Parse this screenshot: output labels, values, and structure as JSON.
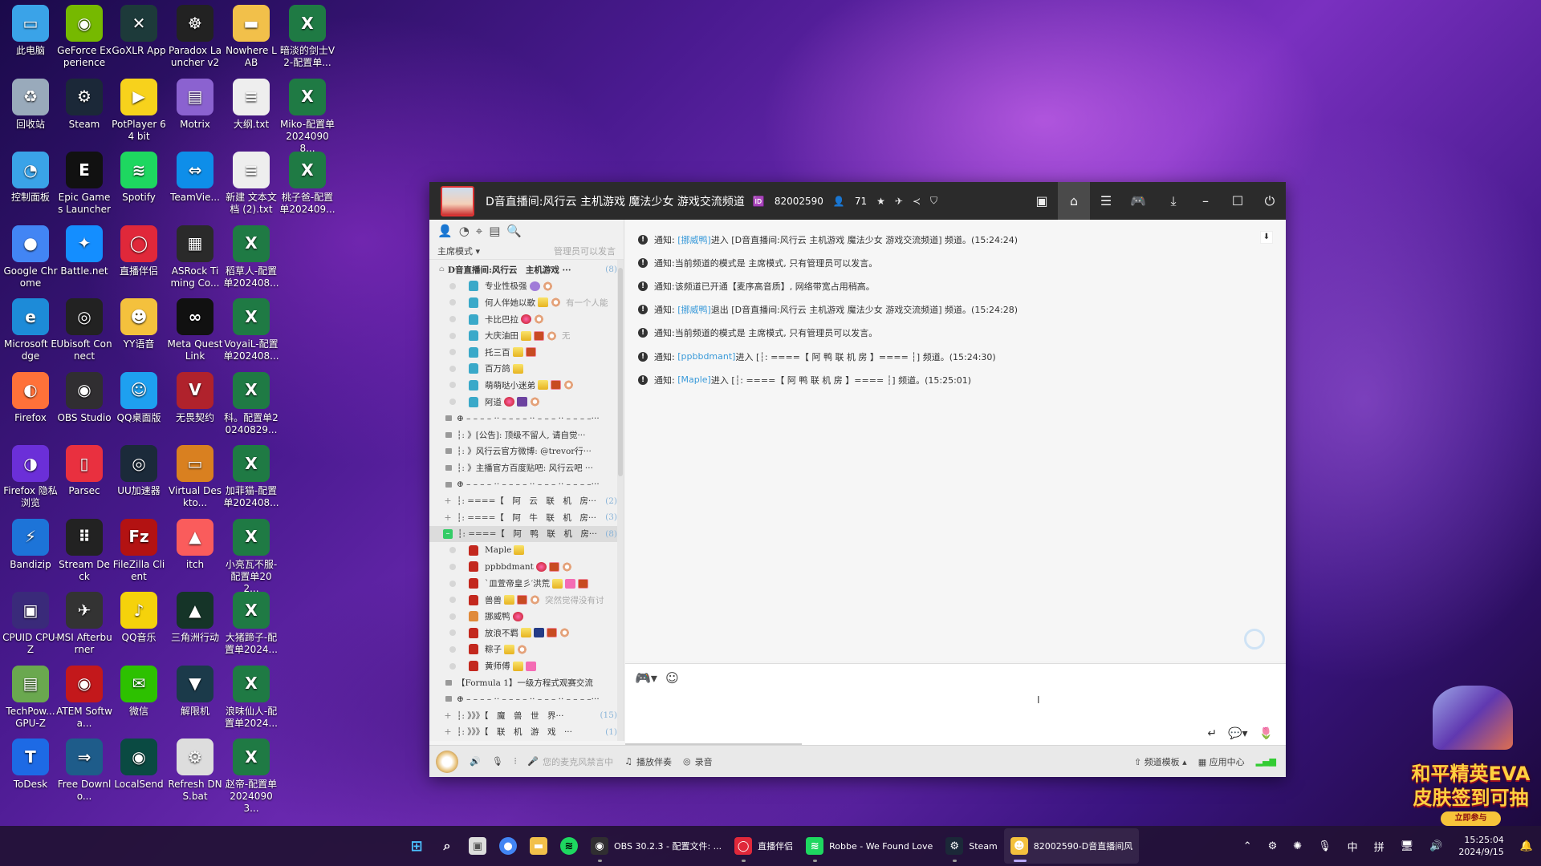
{
  "desktop": {
    "icons": [
      {
        "label": "此电脑",
        "color": "#3aa3e8",
        "glyph": "▭"
      },
      {
        "label": "GeForce Experience",
        "color": "#76b900",
        "glyph": "◉"
      },
      {
        "label": "GoXLR App",
        "color": "#1d3a3a",
        "glyph": "✕"
      },
      {
        "label": "Paradox Launcher v2",
        "color": "#222",
        "glyph": "☸"
      },
      {
        "label": "Nowhere LAB",
        "color": "#f2c04a",
        "glyph": "▬"
      },
      {
        "label": "暗淡的剑士V2-配置单...",
        "color": "#1f7a44",
        "glyph": "X"
      },
      {
        "label": "回收站",
        "color": "#9ab",
        "glyph": "♻"
      },
      {
        "label": "Steam",
        "color": "#1b2838",
        "glyph": "⚙"
      },
      {
        "label": "PotPlayer 64 bit",
        "color": "#f7d21c",
        "glyph": "▶"
      },
      {
        "label": "Motrix",
        "color": "#8b62d0",
        "glyph": "▤"
      },
      {
        "label": "大纲.txt",
        "color": "#eee",
        "glyph": "≡"
      },
      {
        "label": "Miko-配置单20240908...",
        "color": "#1f7a44",
        "glyph": "X"
      },
      {
        "label": "控制面板",
        "color": "#3aa3e8",
        "glyph": "◔"
      },
      {
        "label": "Epic Games Launcher",
        "color": "#111",
        "glyph": "E"
      },
      {
        "label": "Spotify",
        "color": "#1ed760",
        "glyph": "≋"
      },
      {
        "label": "TeamVie...",
        "color": "#0e8ee9",
        "glyph": "⇔"
      },
      {
        "label": "新建 文本文档 (2).txt",
        "color": "#eee",
        "glyph": "≡"
      },
      {
        "label": "桃子爸-配置单202409...",
        "color": "#1f7a44",
        "glyph": "X"
      },
      {
        "label": "Google Chrome",
        "color": "#4285f4",
        "glyph": "●"
      },
      {
        "label": "Battle.net",
        "color": "#148eff",
        "glyph": "✦"
      },
      {
        "label": "直播伴侣",
        "color": "#e0283a",
        "glyph": "◯"
      },
      {
        "label": "ASRock Timing Co...",
        "color": "#2a2a2a",
        "glyph": "▦"
      },
      {
        "label": "稻草人-配置单202408...",
        "color": "#1f7a44",
        "glyph": "X"
      },
      {
        "label": "Microsoft Edge",
        "color": "#1d8bd8",
        "glyph": "e"
      },
      {
        "label": "Ubisoft Connect",
        "color": "#222",
        "glyph": "◎"
      },
      {
        "label": "YY语音",
        "color": "#f4c13d",
        "glyph": "☻"
      },
      {
        "label": "Meta Quest Link",
        "color": "#111",
        "glyph": "∞"
      },
      {
        "label": "VoyaiL-配置单202408...",
        "color": "#1f7a44",
        "glyph": "X"
      },
      {
        "label": "Firefox",
        "color": "#ff7139",
        "glyph": "◐"
      },
      {
        "label": "OBS Studio",
        "color": "#302e31",
        "glyph": "◉"
      },
      {
        "label": "QQ桌面版",
        "color": "#1ea0f0",
        "glyph": "☺"
      },
      {
        "label": "无畏契约",
        "color": "#b0222c",
        "glyph": "V"
      },
      {
        "label": "科。配置单20240829...",
        "color": "#1f7a44",
        "glyph": "X"
      },
      {
        "label": "Firefox 隐私浏览",
        "color": "#6b2fd8",
        "glyph": "◑"
      },
      {
        "label": "Parsec",
        "color": "#e9303f",
        "glyph": "▯"
      },
      {
        "label": "UU加速器",
        "color": "#1b2a3a",
        "glyph": "◎"
      },
      {
        "label": "Virtual Deskto...",
        "color": "#d98020",
        "glyph": "▭"
      },
      {
        "label": "加菲猫-配置单202408...",
        "color": "#1f7a44",
        "glyph": "X"
      },
      {
        "label": "Bandizip",
        "color": "#1d74d8",
        "glyph": "⚡"
      },
      {
        "label": "Stream Deck",
        "color": "#222",
        "glyph": "⠿"
      },
      {
        "label": "FileZilla Client",
        "color": "#b31212",
        "glyph": "Fz"
      },
      {
        "label": "itch",
        "color": "#fa5c5c",
        "glyph": "▲"
      },
      {
        "label": "小亮瓦不服-配置单202...",
        "color": "#1f7a44",
        "glyph": "X"
      },
      {
        "label": "CPUID CPU-Z",
        "color": "#3a2a7a",
        "glyph": "▣"
      },
      {
        "label": "MSI Afterburner",
        "color": "#333",
        "glyph": "✈"
      },
      {
        "label": "QQ音乐",
        "color": "#f5d20b",
        "glyph": "♪"
      },
      {
        "label": "三角洲行动",
        "color": "#153428",
        "glyph": "▲"
      },
      {
        "label": "大猪蹄子-配置单2024...",
        "color": "#1f7a44",
        "glyph": "X"
      },
      {
        "label": "TechPow... GPU-Z",
        "color": "#6aa84f",
        "glyph": "▤"
      },
      {
        "label": "ATEM Softwa...",
        "color": "#c3181b",
        "glyph": "◉"
      },
      {
        "label": "微信",
        "color": "#2dc100",
        "glyph": "✉"
      },
      {
        "label": "解限机",
        "color": "#1b3a4a",
        "glyph": "▼"
      },
      {
        "label": "浪味仙人-配置单2024...",
        "color": "#1f7a44",
        "glyph": "X"
      },
      {
        "label": "ToDesk",
        "color": "#1d6ae5",
        "glyph": "T"
      },
      {
        "label": "Free Downlo...",
        "color": "#1e5c8a",
        "glyph": "⇒"
      },
      {
        "label": "LocalSend",
        "color": "#0a4a42",
        "glyph": "◉"
      },
      {
        "label": "Refresh DNS.bat",
        "color": "#ddd",
        "glyph": "⚙"
      },
      {
        "label": "赵帝-配置单20240903...",
        "color": "#1f7a44",
        "glyph": "X"
      }
    ]
  },
  "window": {
    "title": "D音直播间:风行云 主机游戏 魔法少女 游戏交流频道",
    "channel_id": "82002590",
    "online_count": "71",
    "controls": [
      "video-icon",
      "home-icon",
      "list-icon",
      "gamepad-icon",
      "download-icon",
      "minimize-icon",
      "maximize-icon",
      "power-icon"
    ]
  },
  "left_panel": {
    "mode_label": "主席模式",
    "mode_note": "管理员可以发言",
    "root_channel": {
      "label": "D音直播间:风行云　主机游戏 ···",
      "count": "(8)"
    },
    "root_users": [
      {
        "name": "专业性极强",
        "color": "blue",
        "badges": [
          "purple",
          "ring"
        ],
        "tail": ""
      },
      {
        "name": "何人伴她以歌",
        "color": "blue",
        "badges": [
          "crown-gold",
          "ring"
        ],
        "tail": "有一个人能"
      },
      {
        "name": "卡比巴拉",
        "color": "blue",
        "badges": [
          "crown-red",
          "ring"
        ],
        "tail": ""
      },
      {
        "name": "大庆油田",
        "color": "blue",
        "badges": [
          "crown-gold",
          "cai",
          "ring"
        ],
        "tail": "无"
      },
      {
        "name": "托三百",
        "color": "blue",
        "badges": [
          "crown-gold",
          "cai"
        ],
        "tail": ""
      },
      {
        "name": "百万鸽",
        "color": "blue",
        "badges": [
          "crown-gold"
        ],
        "tail": ""
      },
      {
        "name": "萌萌哒小迷弟",
        "color": "blue",
        "badges": [
          "crown-gold",
          "cai",
          "ring"
        ],
        "tail": ""
      },
      {
        "name": "阿道",
        "color": "blue",
        "badges": [
          "crown-red",
          "zong",
          "ring"
        ],
        "tail": ""
      }
    ],
    "sub_channels_1": [
      {
        "type": "sep",
        "label": "⊕ – – – – ·· – – – – ·· – – – ·· – – – –···"
      },
      {
        "type": "lock",
        "label": "┆: 》[公告]: 顶级不留人, 请自觉···"
      },
      {
        "type": "lock",
        "label": "┆: 》风行云官方微博: @trevor行···"
      },
      {
        "type": "lock",
        "label": "┆: 》主播官方百度贴吧: 风行云吧 ···"
      },
      {
        "type": "sep",
        "label": "⊕ – – – – ·· – – – – ·· – – – ·· – – – –···"
      },
      {
        "type": "plus",
        "label": "┆: ====【　阿　云　联　机　房···",
        "count": "(2)"
      },
      {
        "type": "plus",
        "label": "┆: ====【　阿　牛　联　机　房···",
        "count": "(3)"
      },
      {
        "type": "open",
        "label": "┆: ====【　阿　鸭　联　机　房···",
        "count": "(8)"
      }
    ],
    "duck_users": [
      {
        "name": "Maple",
        "color": "red",
        "badges": [
          "crown-gold"
        ],
        "tail": ""
      },
      {
        "name": "ppbbdmant",
        "color": "red",
        "badges": [
          "crown-red",
          "cai",
          "ring"
        ],
        "tail": ""
      },
      {
        "name": "`皿萱帝皇彡′洪荒",
        "color": "red",
        "badges": [
          "crown-gold",
          "pink",
          "cai"
        ],
        "tail": ""
      },
      {
        "name": "兽兽",
        "color": "red",
        "badges": [
          "crown-gold",
          "cai",
          "ring"
        ],
        "tail": "突然觉得没有讨"
      },
      {
        "name": "挪威鸭",
        "color": "orange",
        "badges": [
          "crown-red"
        ],
        "tail": ""
      },
      {
        "name": "放浪不羁",
        "color": "red",
        "badges": [
          "crown-gold",
          "l",
          "cai",
          "ring"
        ],
        "tail": ""
      },
      {
        "name": "粽子",
        "color": "red",
        "badges": [
          "crown-gold",
          "ring"
        ],
        "tail": ""
      },
      {
        "name": "黄师傅",
        "color": "red",
        "badges": [
          "crown-gold",
          "pink"
        ],
        "tail": ""
      }
    ],
    "sub_channels_2": [
      {
        "type": "lock",
        "label": "【Formula 1】一级方程式观赛交流"
      },
      {
        "type": "sep",
        "label": "⊕ – – – – ·· – – – – ·· – – – ·· – – – –···"
      },
      {
        "type": "plus",
        "label": "┆: 》》》【　魔　兽　世　界···",
        "count": "(15)"
      },
      {
        "type": "plus",
        "label": "┆: 》》》【　联　机　游　戏　···",
        "count": "(1)"
      }
    ]
  },
  "chat": {
    "messages": [
      {
        "prefix": "通知:",
        "user": "[挪威鸭]",
        "text": " 进入 [D音直播间:风行云  主机游戏 魔法少女 游戏交流频道] 频道。(15:24:24)"
      },
      {
        "prefix": "通知:",
        "user": "",
        "text": " 当前频道的模式是 主席模式, 只有管理员可以发言。"
      },
      {
        "prefix": "通知:",
        "user": "",
        "text": " 该频道已开通【麦序高音质】, 网络带宽占用稍高。"
      },
      {
        "prefix": "通知:",
        "user": "[挪威鸭]",
        "text": " 退出 [D音直播间:风行云  主机游戏 魔法少女 游戏交流频道] 频道。(15:24:28)"
      },
      {
        "prefix": "通知:",
        "user": "",
        "text": " 当前频道的模式是 主席模式, 只有管理员可以发言。"
      },
      {
        "prefix": "通知:",
        "user": "[ppbbdmant]",
        "text": " 进入 [┆:  ====【  阿  鸭  联  机  房  】====  ┆] 频道。(15:24:30)"
      },
      {
        "prefix": "通知:",
        "user": "[Maple]",
        "text": " 进入 [┆:  ====【  阿  鸭  联  机  房  】====  ┆] 频道。(15:25:01)"
      }
    ]
  },
  "input": {
    "value": ""
  },
  "bottom_bar": {
    "mic_disabled_text": "您的麦克风禁言中",
    "play_accompaniment": "播放伴奏",
    "record": "录音",
    "channel_template": "频道模板",
    "app_center": "应用中心"
  },
  "promo": {
    "line1": "和平精英EVA",
    "line2": "皮肤签到可抽",
    "button": "立即参与"
  },
  "taskbar": {
    "items": [
      {
        "label": "OBS 30.2.3 - 配置文件: ...",
        "icon": "obs-icon",
        "color": "#302e31",
        "glyph": "◉",
        "active": false
      },
      {
        "label": "直播伴侣",
        "icon": "live-companion-icon",
        "color": "#e0283a",
        "glyph": "◯",
        "active": false
      },
      {
        "label": "Robbe - We Found Love",
        "icon": "spotify-icon",
        "color": "#1ed760",
        "glyph": "≋",
        "active": false
      },
      {
        "label": "Steam",
        "icon": "steam-icon",
        "color": "#1b2838",
        "glyph": "⚙",
        "active": false
      },
      {
        "label": "82002590-D音直播间风",
        "icon": "yy-icon",
        "color": "#f4c13d",
        "glyph": "☻",
        "active": true
      }
    ],
    "tray": {
      "ime_lang": "中",
      "ime_mode": "拼",
      "time": "15:25:04",
      "date": "2024/9/15"
    }
  }
}
